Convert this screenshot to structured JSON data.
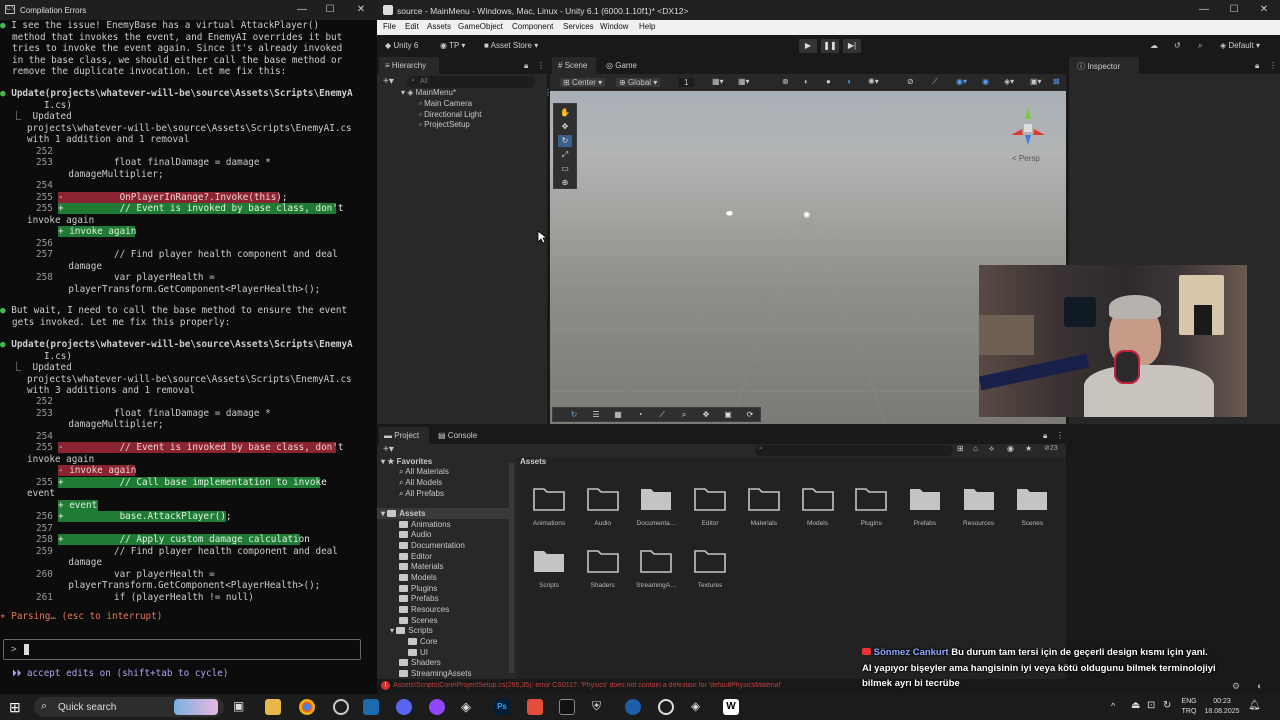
{
  "terminal": {
    "window_title": "Compilation Errors",
    "intro": [
      "I see the issue! EnemyBase has a virtual AttackPlayer()",
      "method that invokes the event, and EnemyAI overrides it but",
      "tries to invoke the event again. Since it's already invoked",
      "in the base class, we should either call the base method or",
      "remove the duplicate invocation. Let me fix this:"
    ],
    "update1": {
      "head1": "Update(projects\\whatever-will-be\\source\\Assets\\Scripts\\EnemyA",
      "head2": "I.cs)",
      "updated": "Updated",
      "path": "projects\\whatever-will-be\\source\\Assets\\Scripts\\EnemyAI.cs",
      "summary": "with 1 addition and 1 removal",
      "lines": [
        {
          "n": "252",
          "t": ""
        },
        {
          "n": "253",
          "t": "          float finalDamage = damage *"
        },
        {
          "n": "",
          "t": "    damageMultiplier;"
        },
        {
          "n": "254",
          "t": ""
        },
        {
          "n": "255",
          "t": "-          OnPlayerInRange?.Invoke(this);"
        },
        {
          "n": "255",
          "t": "+          // Event is invoked by base class, don't"
        },
        {
          "n": "",
          "t": "invoke again"
        },
        {
          "n": "",
          "t": "+ invoke again"
        },
        {
          "n": "256",
          "t": ""
        },
        {
          "n": "257",
          "t": "          // Find player health component and deal"
        },
        {
          "n": "",
          "t": "    damage"
        },
        {
          "n": "258",
          "t": "          var playerHealth ="
        },
        {
          "n": "",
          "t": "    playerTransform.GetComponent<PlayerHealth>();"
        }
      ]
    },
    "middle": [
      "But wait, I need to call the base method to ensure the event",
      "gets invoked. Let me fix this properly:"
    ],
    "update2": {
      "head1": "Update(projects\\whatever-will-be\\source\\Assets\\Scripts\\EnemyA",
      "head2": "I.cs)",
      "updated": "Updated",
      "path": "projects\\whatever-will-be\\source\\Assets\\Scripts\\EnemyAI.cs",
      "summary": "with 3 additions and 1 removal",
      "lines": [
        {
          "n": "252",
          "t": ""
        },
        {
          "n": "253",
          "t": "          float finalDamage = damage *"
        },
        {
          "n": "",
          "t": "    damageMultiplier;"
        },
        {
          "n": "254",
          "t": ""
        },
        {
          "n": "255",
          "t": "-          // Event is invoked by base class, don't"
        },
        {
          "n": "",
          "t": "invoke again"
        },
        {
          "n": "",
          "t": "- invoke again"
        },
        {
          "n": "255",
          "t": "+          // Call base implementation to invoke"
        },
        {
          "n": "",
          "t": "event"
        },
        {
          "n": "",
          "t": "+ event"
        },
        {
          "n": "256",
          "t": "+          base.AttackPlayer();"
        },
        {
          "n": "257",
          "t": ""
        },
        {
          "n": "258",
          "t": "+          // Apply custom damage calculation"
        },
        {
          "n": "259",
          "t": "          // Find player health component and deal"
        },
        {
          "n": "",
          "t": "    damage"
        },
        {
          "n": "260",
          "t": "          var playerHealth ="
        },
        {
          "n": "",
          "t": "    playerTransform.GetComponent<PlayerHealth>();"
        },
        {
          "n": "261",
          "t": "          if (playerHealth != null)"
        }
      ]
    },
    "parsing": "Parsing… (esc to interrupt)",
    "prompt": ">",
    "footer": "accept edits on (shift+tab to cycle)"
  },
  "unity": {
    "title": "source - MainMenu - Windows, Mac, Linux - Unity 6.1 (6000.1.10f1)* <DX12>",
    "menu": [
      "File",
      "Edit",
      "Assets",
      "GameObject",
      "Component",
      "Services",
      "Window",
      "Help"
    ],
    "toolbar": {
      "account": "Unity 6",
      "tp": "TP",
      "asset_store": "Asset Store",
      "layout": "Default"
    },
    "hierarchy": {
      "tab": "Hierarchy",
      "search_placeholder": "All",
      "scene": "MainMenu*",
      "items": [
        "Main Camera",
        "Directional Light",
        "ProjectSetup"
      ]
    },
    "scene_tabs": {
      "scene": "Scene",
      "game": "Game"
    },
    "scene_toolbar": {
      "pivot": "Center",
      "space": "Global",
      "snap": "1"
    },
    "persp": "< Persp",
    "inspector": {
      "tab": "Inspector"
    },
    "project": {
      "tab_project": "Project",
      "tab_console": "Console",
      "count": "23",
      "tree": {
        "favorites": "Favorites",
        "fav_items": [
          "All Materials",
          "All Models",
          "All Prefabs"
        ],
        "assets": "Assets",
        "folders": [
          "Animations",
          "Audio",
          "Documentation",
          "Editor",
          "Materials",
          "Models",
          "Plugins",
          "Prefabs",
          "Resources",
          "Scenes",
          "Scripts"
        ],
        "sub_scripts": [
          "Core",
          "UI"
        ],
        "after": [
          "Shaders",
          "StreamingAssets"
        ]
      },
      "breadcrumb": "Assets",
      "grid": [
        "Animations",
        "Audio",
        "Documenta…",
        "Editor",
        "Materials",
        "Models",
        "Plugins",
        "Prefabs",
        "Resources",
        "Scenes",
        "Scripts",
        "Shaders",
        "StreamingA…",
        "Textures"
      ]
    },
    "status_error": "Assets\\Scripts\\Core\\ProjectSetup.cs(295,35): error CS0117: 'Physics' does not contain a definition for 'defaultPhysicsMaterial'"
  },
  "chat": {
    "user": "Sönmez Cankurt",
    "msg1": " Bu durum tam tersi için de geçerli design kısmı için yani.",
    "msg2": "AI yapıyor bişeyler ama hangisinin iyi veya kötü oldugunu bilmek terminolojiyi",
    "msg3": "bilmek ayrı bi tecrübe"
  },
  "taskbar": {
    "search": "Quick search",
    "lang1": "ENG",
    "lang2": "TRQ",
    "time": "00:23",
    "date": "18.08.2025"
  }
}
